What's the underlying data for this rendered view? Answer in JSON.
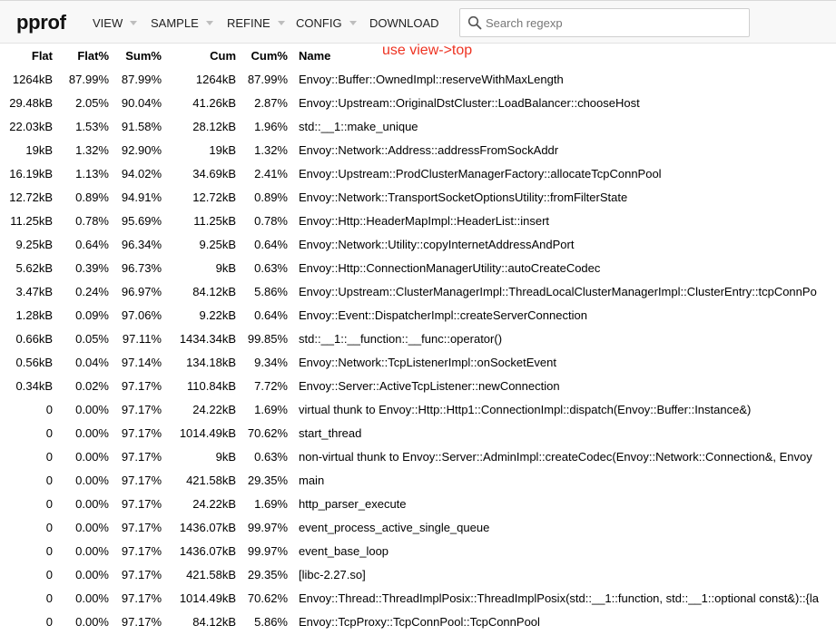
{
  "app": {
    "logo": "pprof"
  },
  "menu": [
    "VIEW",
    "SAMPLE",
    "REFINE",
    "CONFIG",
    "DOWNLOAD"
  ],
  "search": {
    "placeholder": "Search regexp",
    "value": ""
  },
  "annotation": "use view->top",
  "columns": [
    "Flat",
    "Flat%",
    "Sum%",
    "Cum",
    "Cum%",
    "Name"
  ],
  "rows": [
    [
      "1264kB",
      "87.99%",
      "87.99%",
      "1264kB",
      "87.99%",
      "Envoy::Buffer::OwnedImpl::reserveWithMaxLength"
    ],
    [
      "29.48kB",
      "2.05%",
      "90.04%",
      "41.26kB",
      "2.87%",
      "Envoy::Upstream::OriginalDstCluster::LoadBalancer::chooseHost"
    ],
    [
      "22.03kB",
      "1.53%",
      "91.58%",
      "28.12kB",
      "1.96%",
      "std::__1::make_unique"
    ],
    [
      "19kB",
      "1.32%",
      "92.90%",
      "19kB",
      "1.32%",
      "Envoy::Network::Address::addressFromSockAddr"
    ],
    [
      "16.19kB",
      "1.13%",
      "94.02%",
      "34.69kB",
      "2.41%",
      "Envoy::Upstream::ProdClusterManagerFactory::allocateTcpConnPool"
    ],
    [
      "12.72kB",
      "0.89%",
      "94.91%",
      "12.72kB",
      "0.89%",
      "Envoy::Network::TransportSocketOptionsUtility::fromFilterState"
    ],
    [
      "11.25kB",
      "0.78%",
      "95.69%",
      "11.25kB",
      "0.78%",
      "Envoy::Http::HeaderMapImpl::HeaderList::insert"
    ],
    [
      "9.25kB",
      "0.64%",
      "96.34%",
      "9.25kB",
      "0.64%",
      "Envoy::Network::Utility::copyInternetAddressAndPort"
    ],
    [
      "5.62kB",
      "0.39%",
      "96.73%",
      "9kB",
      "0.63%",
      "Envoy::Http::ConnectionManagerUtility::autoCreateCodec"
    ],
    [
      "3.47kB",
      "0.24%",
      "96.97%",
      "84.12kB",
      "5.86%",
      "Envoy::Upstream::ClusterManagerImpl::ThreadLocalClusterManagerImpl::ClusterEntry::tcpConnPo"
    ],
    [
      "1.28kB",
      "0.09%",
      "97.06%",
      "9.22kB",
      "0.64%",
      "Envoy::Event::DispatcherImpl::createServerConnection"
    ],
    [
      "0.66kB",
      "0.05%",
      "97.11%",
      "1434.34kB",
      "99.85%",
      "std::__1::__function::__func::operator()"
    ],
    [
      "0.56kB",
      "0.04%",
      "97.14%",
      "134.18kB",
      "9.34%",
      "Envoy::Network::TcpListenerImpl::onSocketEvent"
    ],
    [
      "0.34kB",
      "0.02%",
      "97.17%",
      "110.84kB",
      "7.72%",
      "Envoy::Server::ActiveTcpListener::newConnection"
    ],
    [
      "0",
      "0.00%",
      "97.17%",
      "24.22kB",
      "1.69%",
      "virtual thunk to Envoy::Http::Http1::ConnectionImpl::dispatch(Envoy::Buffer::Instance&)"
    ],
    [
      "0",
      "0.00%",
      "97.17%",
      "1014.49kB",
      "70.62%",
      "start_thread"
    ],
    [
      "0",
      "0.00%",
      "97.17%",
      "9kB",
      "0.63%",
      "non-virtual thunk to Envoy::Server::AdminImpl::createCodec(Envoy::Network::Connection&, Envoy"
    ],
    [
      "0",
      "0.00%",
      "97.17%",
      "421.58kB",
      "29.35%",
      "main"
    ],
    [
      "0",
      "0.00%",
      "97.17%",
      "24.22kB",
      "1.69%",
      "http_parser_execute"
    ],
    [
      "0",
      "0.00%",
      "97.17%",
      "1436.07kB",
      "99.97%",
      "event_process_active_single_queue"
    ],
    [
      "0",
      "0.00%",
      "97.17%",
      "1436.07kB",
      "99.97%",
      "event_base_loop"
    ],
    [
      "0",
      "0.00%",
      "97.17%",
      "421.58kB",
      "29.35%",
      "[libc-2.27.so]"
    ],
    [
      "0",
      "0.00%",
      "97.17%",
      "1014.49kB",
      "70.62%",
      "Envoy::Thread::ThreadImplPosix::ThreadImplPosix(std::__1::function, std::__1::optional const&)::{la"
    ],
    [
      "0",
      "0.00%",
      "97.17%",
      "84.12kB",
      "5.86%",
      "Envoy::TcpProxy::TcpConnPool::TcpConnPool"
    ]
  ]
}
